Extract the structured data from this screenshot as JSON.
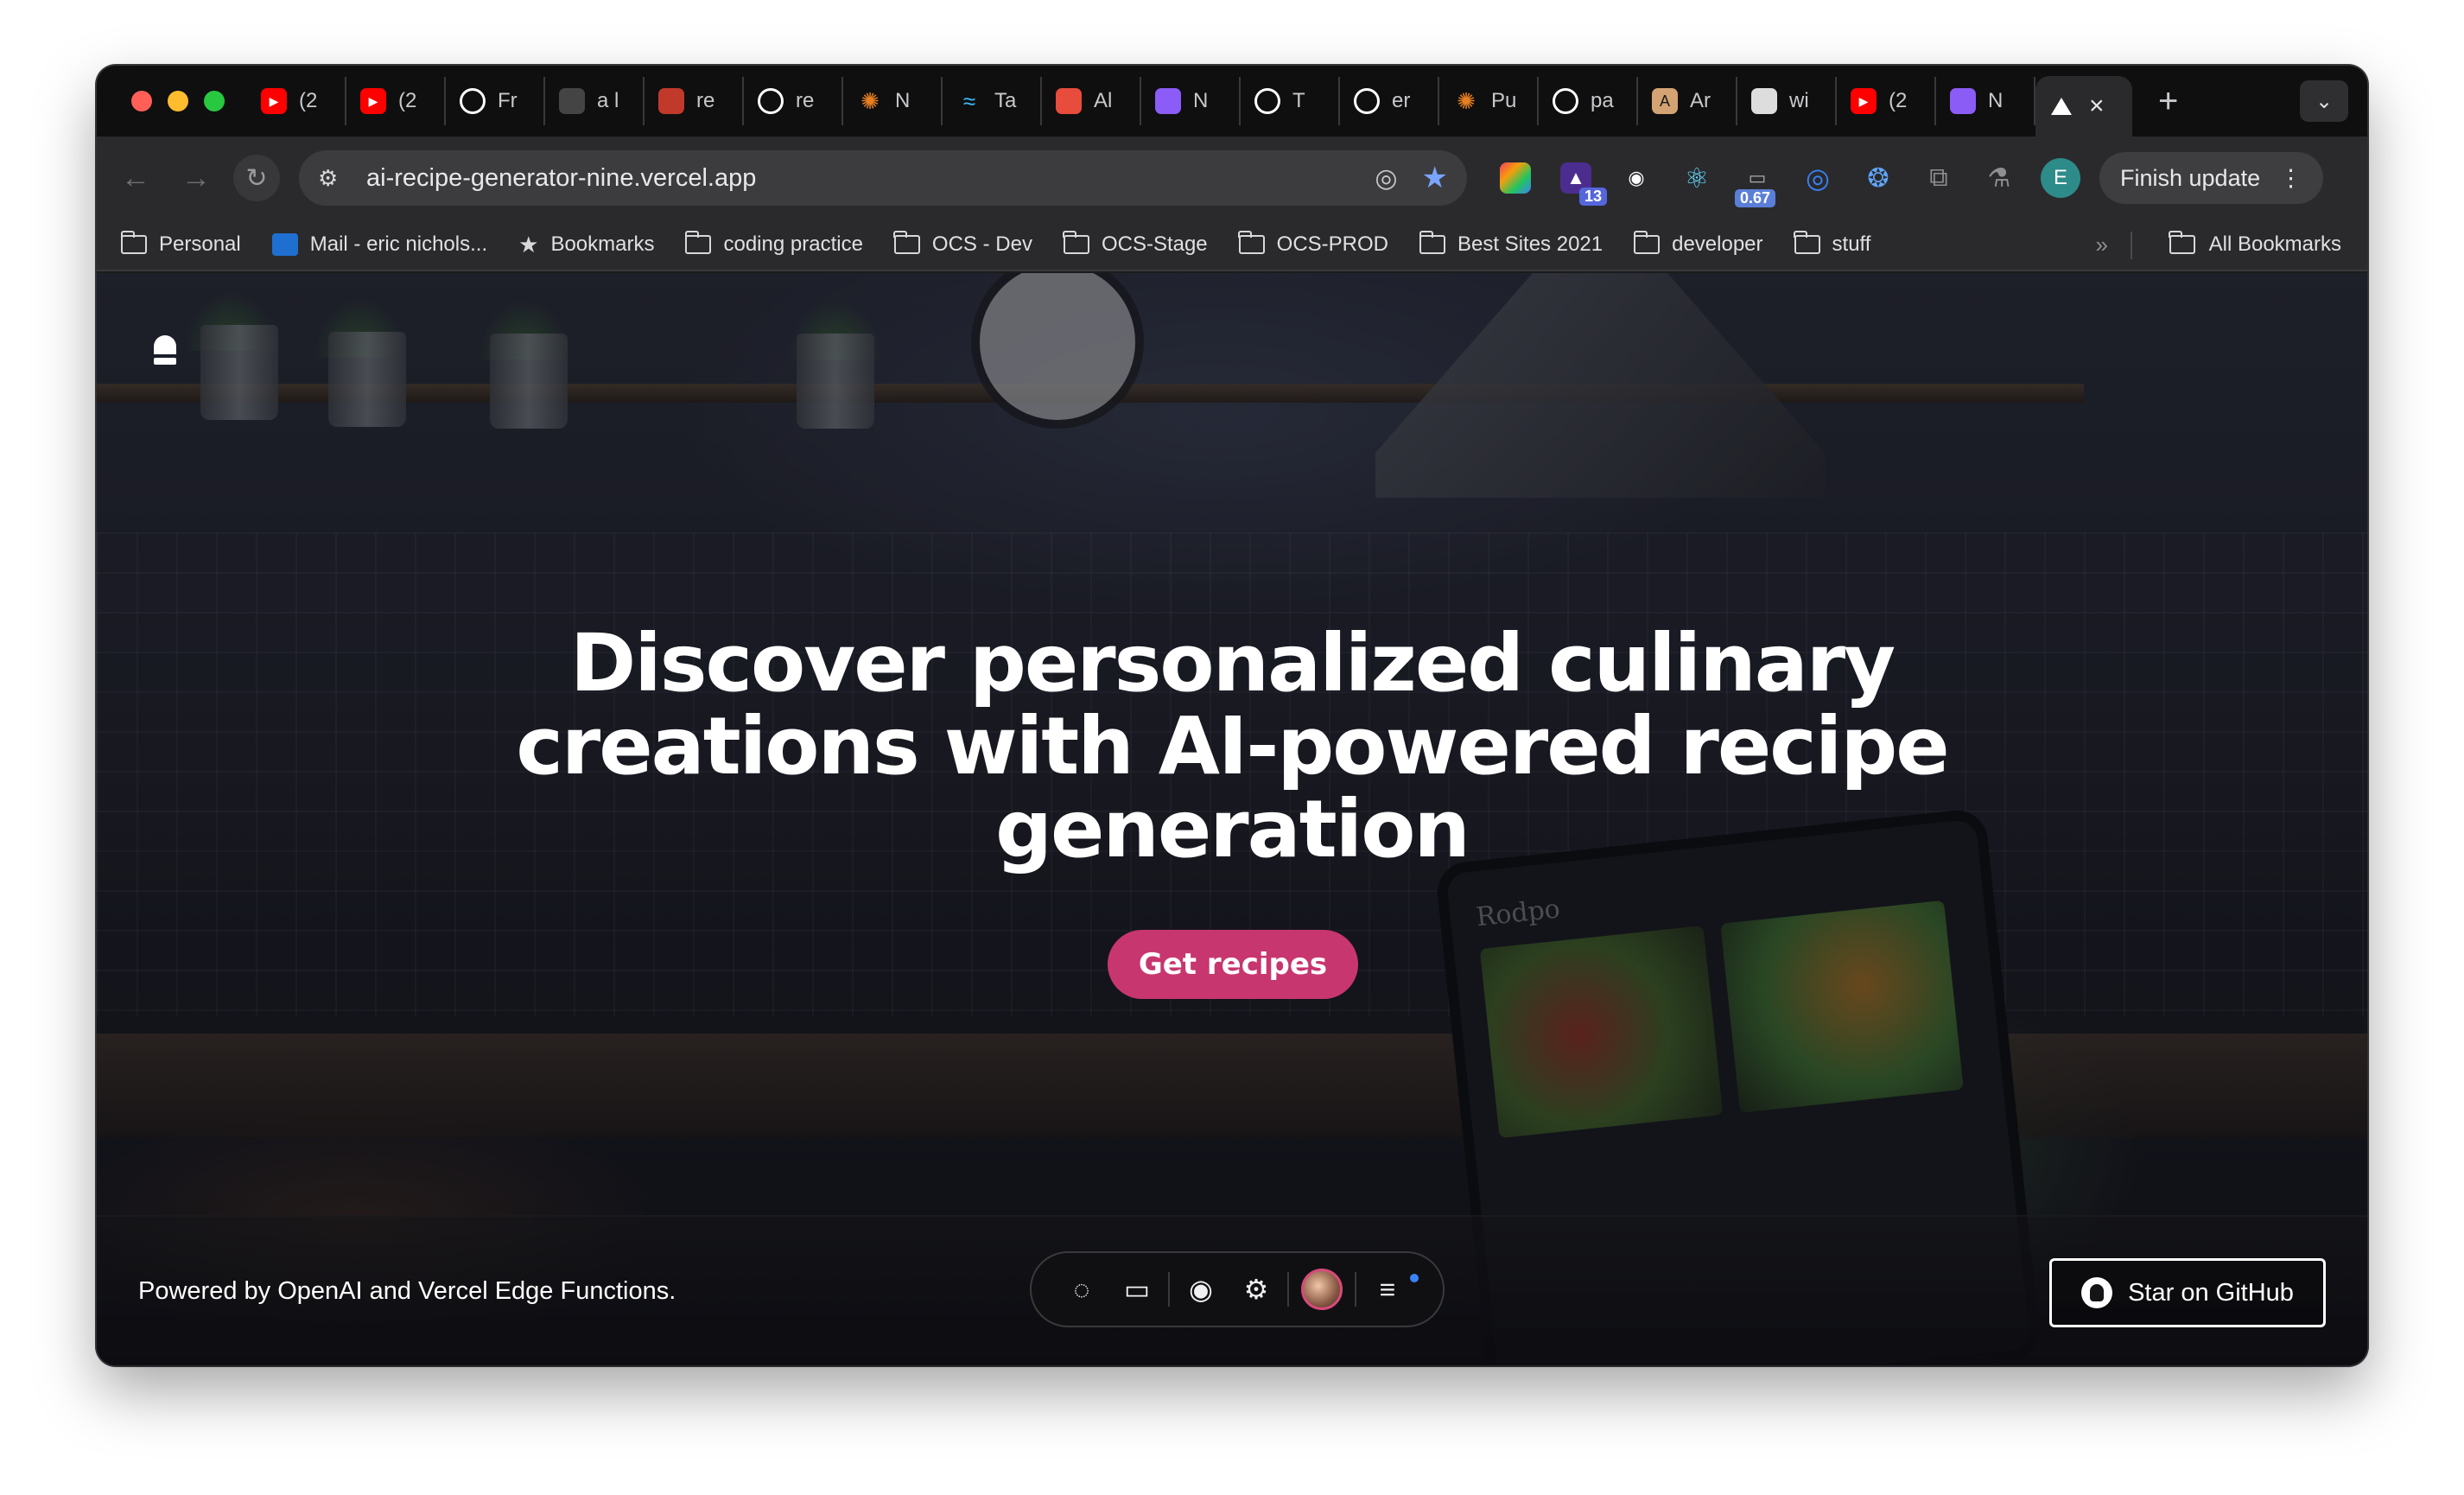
{
  "browser": {
    "tabs": [
      {
        "label": "(2",
        "icon": "youtube-icon",
        "color": "#ff0000"
      },
      {
        "label": "(2",
        "icon": "youtube-icon",
        "color": "#ff0000"
      },
      {
        "label": "Fr",
        "icon": "github-icon",
        "color": "#ffffff"
      },
      {
        "label": "a l",
        "icon": "blank-icon",
        "color": "#444444"
      },
      {
        "label": "re",
        "icon": "app-icon",
        "color": "#c0392b"
      },
      {
        "label": "re",
        "icon": "github-icon",
        "color": "#ffffff"
      },
      {
        "label": "N",
        "icon": "sparkle-icon",
        "color": "#e67e22"
      },
      {
        "label": "Ta",
        "icon": "tailwind-icon",
        "color": "#38bdf8"
      },
      {
        "label": "Al",
        "icon": "chart-icon",
        "color": "#e74c3c"
      },
      {
        "label": "N",
        "icon": "app-icon",
        "color": "#8b5cf6"
      },
      {
        "label": "T",
        "icon": "ring-icon",
        "color": "#ffffff"
      },
      {
        "label": "er",
        "icon": "github-icon",
        "color": "#ffffff"
      },
      {
        "label": "Pu",
        "icon": "sparkle-icon",
        "color": "#e67e22"
      },
      {
        "label": "pa",
        "icon": "github-icon",
        "color": "#ffffff"
      },
      {
        "label": "Ar",
        "icon": "anthropic-icon",
        "color": "#d4a373"
      },
      {
        "label": "wi",
        "icon": "app-icon",
        "color": "#dddddd"
      },
      {
        "label": "(2",
        "icon": "youtube-icon",
        "color": "#ff0000"
      },
      {
        "label": "N",
        "icon": "app-icon",
        "color": "#8b5cf6"
      }
    ],
    "active_tab_icon": "vercel-triangle-icon",
    "url": "ai-recipe-generator-nine.vercel.app",
    "extension_badges": {
      "notifications": "13",
      "score": "0.67"
    },
    "profile_initial": "E",
    "finish_update_label": "Finish update",
    "bookmarks": [
      {
        "label": "Personal",
        "icon": "folder-icon"
      },
      {
        "label": "Mail - eric nichols...",
        "icon": "outlook-icon"
      },
      {
        "label": "Bookmarks",
        "icon": "star-icon"
      },
      {
        "label": "coding practice",
        "icon": "folder-icon"
      },
      {
        "label": "OCS - Dev",
        "icon": "folder-icon"
      },
      {
        "label": "OCS-Stage",
        "icon": "folder-icon"
      },
      {
        "label": "OCS-PROD",
        "icon": "folder-icon"
      },
      {
        "label": "Best Sites 2021",
        "icon": "folder-icon"
      },
      {
        "label": "developer",
        "icon": "folder-icon"
      },
      {
        "label": "stuff",
        "icon": "folder-icon"
      }
    ],
    "all_bookmarks_label": "All Bookmarks"
  },
  "page": {
    "hero_lines": [
      "Discover personalized culinary",
      "creations with AI-powered recipe",
      "generation"
    ],
    "cta_label": "Get recipes",
    "background_text": "Rodpo",
    "footer": {
      "powered_by": "Powered by OpenAI and Vercel Edge Functions.",
      "github_label": "Star on GitHub"
    },
    "toolbar_icons": [
      "chat-icon",
      "inbox-icon",
      "eye-icon",
      "settings-icon",
      "user-avatar",
      "menu-icon"
    ]
  },
  "colors": {
    "cta": "#c8366f",
    "accent_link": "#7aa5ff"
  }
}
